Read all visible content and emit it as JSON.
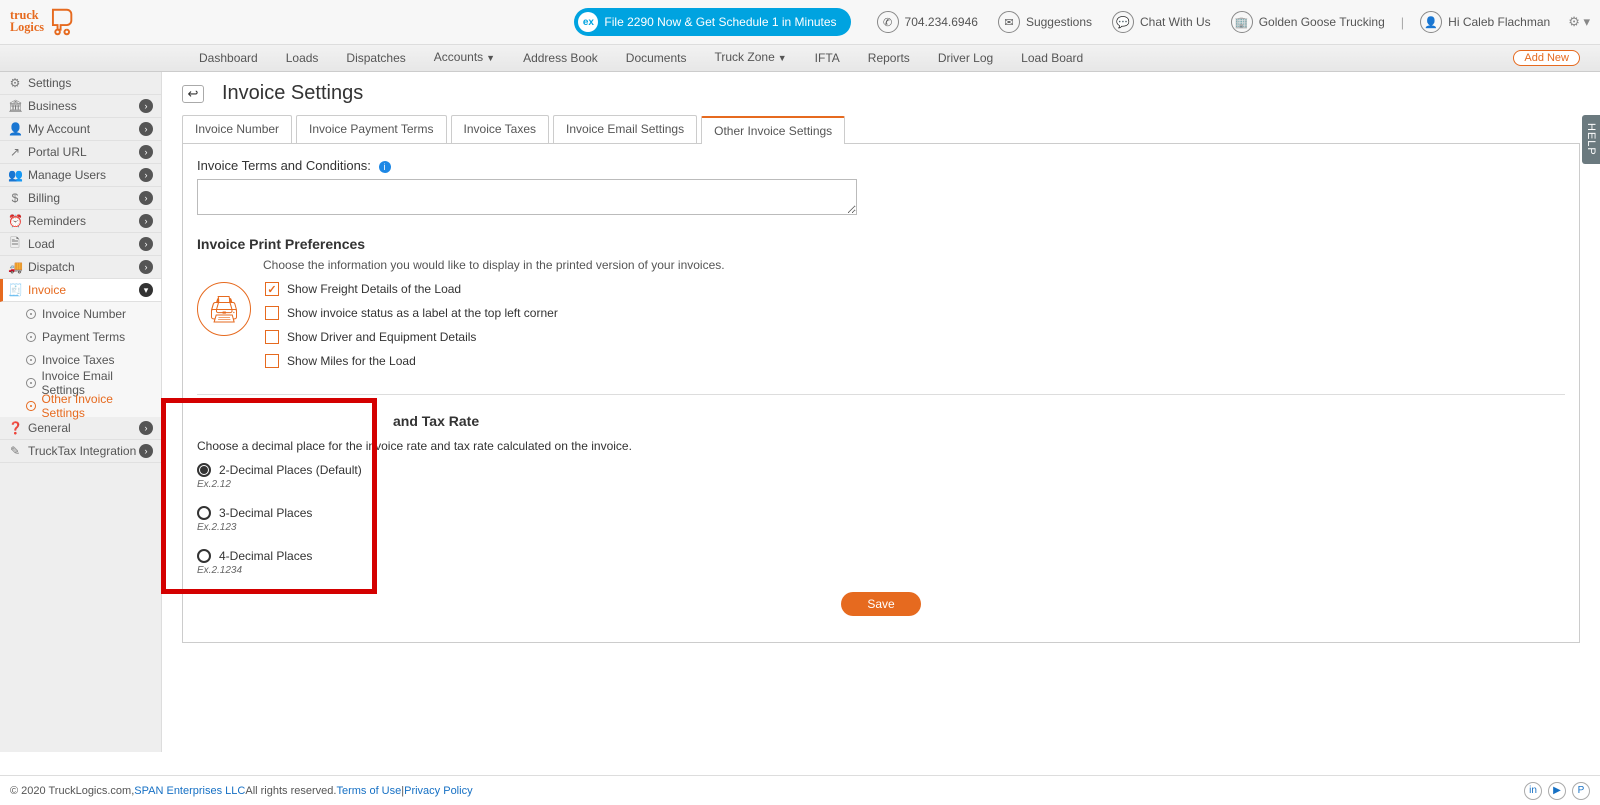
{
  "header": {
    "promo": "File 2290 Now & Get Schedule 1 in Minutes",
    "phone": "704.234.6946",
    "suggestions": "Suggestions",
    "chat": "Chat With Us",
    "company": "Golden Goose Trucking",
    "greeting": "Hi Caleb Flachman"
  },
  "nav": {
    "items": [
      "Dashboard",
      "Loads",
      "Dispatches",
      "Accounts",
      "Address Book",
      "Documents",
      "Truck Zone",
      "IFTA",
      "Reports",
      "Driver Log",
      "Load Board"
    ],
    "add_new": "Add New"
  },
  "sidebar": {
    "items": [
      {
        "icon": "⚙",
        "label": "Settings",
        "arrow": false
      },
      {
        "icon": "🏛",
        "label": "Business",
        "arrow": true
      },
      {
        "icon": "👤",
        "label": "My Account",
        "arrow": true
      },
      {
        "icon": "↗",
        "label": "Portal URL",
        "arrow": true
      },
      {
        "icon": "👥",
        "label": "Manage Users",
        "arrow": true
      },
      {
        "icon": "$",
        "label": "Billing",
        "arrow": true
      },
      {
        "icon": "⏰",
        "label": "Reminders",
        "arrow": true
      },
      {
        "icon": "🗎",
        "label": "Load",
        "arrow": true
      },
      {
        "icon": "🚚",
        "label": "Dispatch",
        "arrow": true
      },
      {
        "icon": "🧾",
        "label": "Invoice",
        "arrow": true,
        "active": true
      },
      {
        "icon": "❓",
        "label": "General",
        "arrow": true
      },
      {
        "icon": "✎",
        "label": "TruckTax Integration",
        "arrow": true
      }
    ],
    "invoice_sub": [
      "Invoice Number",
      "Payment Terms",
      "Invoice Taxes",
      "Invoice Email Settings",
      "Other Invoice Settings"
    ]
  },
  "page": {
    "title": "Invoice Settings",
    "tabs": [
      "Invoice Number",
      "Invoice Payment Terms",
      "Invoice Taxes",
      "Invoice Email Settings",
      "Other Invoice Settings"
    ],
    "terms_label": "Invoice Terms and Conditions:",
    "print_title": "Invoice Print Preferences",
    "print_desc": "Choose the information you would like to display in the printed version of your invoices.",
    "print_checks": [
      {
        "label": "Show Freight Details of the Load",
        "checked": true
      },
      {
        "label": "Show invoice status as a label at the top left corner",
        "checked": false
      },
      {
        "label": "Show Driver and Equipment Details",
        "checked": false
      },
      {
        "label": "Show Miles for the Load",
        "checked": false
      }
    ],
    "decimal_title_suffix": "and Tax Rate",
    "decimal_desc": "Choose a decimal place for the invoice rate and tax rate calculated on the invoice.",
    "radios": [
      {
        "label": "2-Decimal Places (Default)",
        "example": "Ex.2.12",
        "selected": true
      },
      {
        "label": "3-Decimal Places",
        "example": "Ex.2.123",
        "selected": false
      },
      {
        "label": "4-Decimal Places",
        "example": "Ex.2.1234",
        "selected": false
      }
    ],
    "save": "Save"
  },
  "footer": {
    "copyright": "© 2020 TruckLogics.com, ",
    "span_ent": "SPAN Enterprises LLC",
    "rights": " All rights reserved. ",
    "terms": "Terms of Use",
    "pipe": " | ",
    "privacy": "Privacy Policy"
  },
  "help": "HELP"
}
